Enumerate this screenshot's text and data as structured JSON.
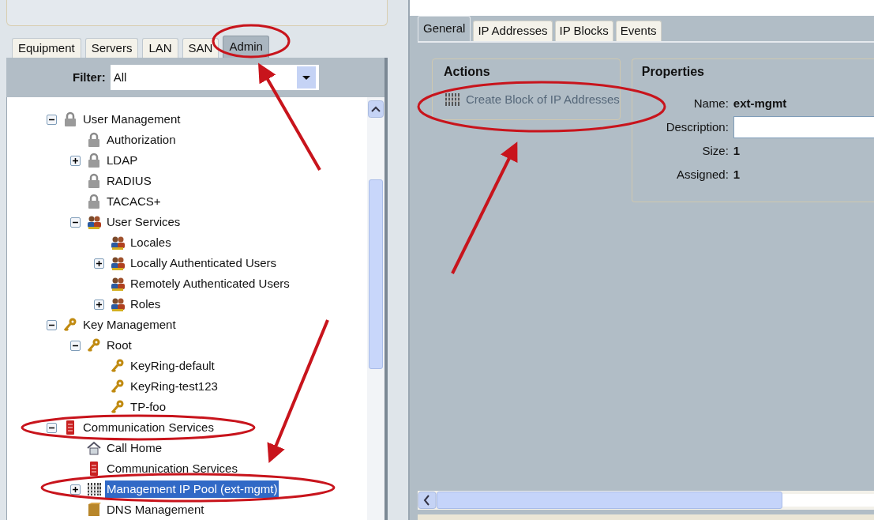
{
  "nav_tabs": [
    {
      "label": "Equipment",
      "selected": false
    },
    {
      "label": "Servers",
      "selected": false
    },
    {
      "label": "LAN",
      "selected": false
    },
    {
      "label": "SAN",
      "selected": false
    },
    {
      "label": "Admin",
      "selected": true
    }
  ],
  "filter": {
    "label": "Filter:",
    "value": "All"
  },
  "tree": [
    {
      "label": "User Management",
      "kind": "lock",
      "selected": false,
      "expanded": true,
      "children": [
        {
          "label": "Authorization",
          "kind": "lock",
          "selected": false
        },
        {
          "label": "LDAP",
          "kind": "lock",
          "selected": false,
          "expanded": false
        },
        {
          "label": "RADIUS",
          "kind": "lock",
          "selected": false
        },
        {
          "label": "TACACS+",
          "kind": "lock",
          "selected": false
        },
        {
          "label": "User Services",
          "kind": "users",
          "selected": false,
          "expanded": true,
          "children": [
            {
              "label": "Locales",
              "kind": "users",
              "selected": false
            },
            {
              "label": "Locally Authenticated Users",
              "kind": "users",
              "selected": false,
              "expanded": false
            },
            {
              "label": "Remotely Authenticated Users",
              "kind": "users",
              "selected": false
            },
            {
              "label": "Roles",
              "kind": "users",
              "selected": false,
              "expanded": false
            }
          ]
        }
      ]
    },
    {
      "label": "Key Management",
      "kind": "key",
      "selected": false,
      "expanded": true,
      "children": [
        {
          "label": "Root",
          "kind": "key",
          "selected": false,
          "expanded": true,
          "children": [
            {
              "label": "KeyRing-default",
              "kind": "key",
              "selected": false
            },
            {
              "label": "KeyRing-test123",
              "kind": "key",
              "selected": false
            },
            {
              "label": "TP-foo",
              "kind": "key",
              "selected": false
            }
          ]
        }
      ]
    },
    {
      "label": "Communication Services",
      "kind": "server",
      "selected": false,
      "expanded": true,
      "children": [
        {
          "label": "Call Home",
          "kind": "house",
          "selected": false
        },
        {
          "label": "Communication Services",
          "kind": "server",
          "selected": false
        },
        {
          "label": "Management IP Pool (ext-mgmt)",
          "kind": "pool",
          "selected": true,
          "expanded": false
        },
        {
          "label": "DNS Management",
          "kind": "box",
          "selected": false
        }
      ]
    }
  ],
  "detail_tabs": [
    {
      "label": "General",
      "selected": true
    },
    {
      "label": "IP Addresses",
      "selected": false
    },
    {
      "label": "IP Blocks",
      "selected": false
    },
    {
      "label": "Events",
      "selected": false
    }
  ],
  "actions": {
    "title": "Actions",
    "items": [
      {
        "label": "Create Block of IP Addresses"
      }
    ]
  },
  "properties": {
    "title": "Properties",
    "fields": [
      {
        "label": "Name:",
        "kind": "text",
        "value": "ext-mgmt"
      },
      {
        "label": "Description:",
        "kind": "input"
      },
      {
        "label": "Size:",
        "kind": "text",
        "value": "1"
      },
      {
        "label": "Assigned:",
        "kind": "text",
        "value": "1"
      }
    ]
  }
}
